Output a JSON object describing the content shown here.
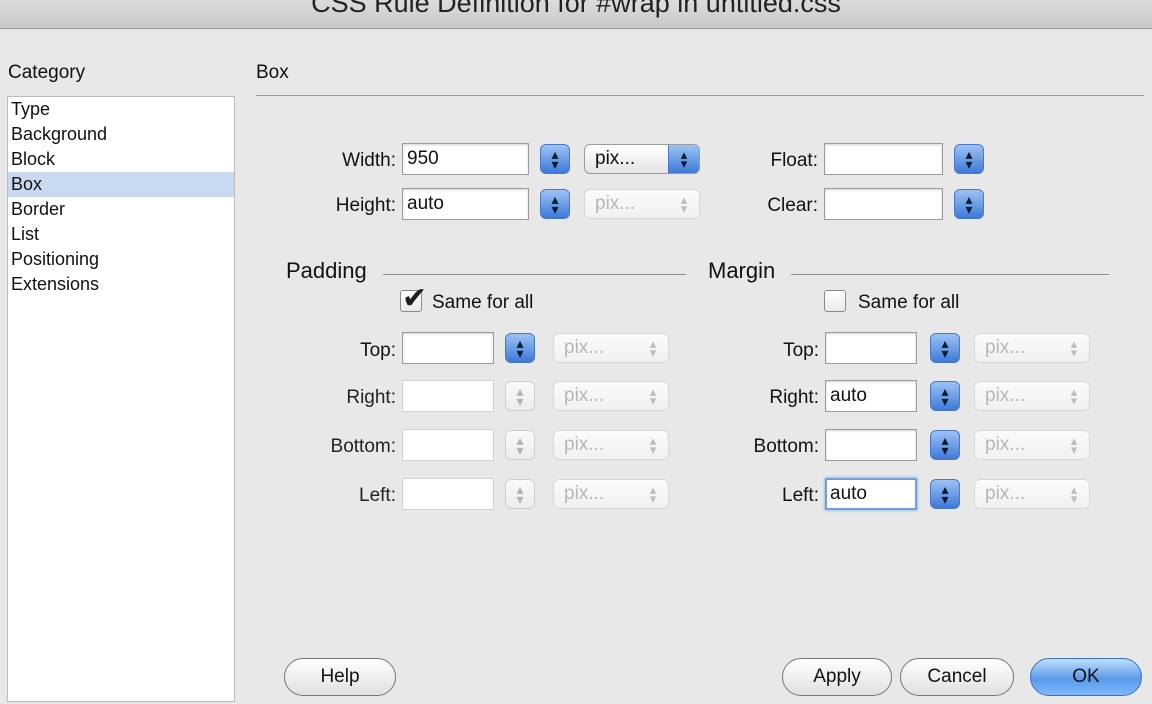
{
  "window": {
    "title": "CSS Rule Definition for #wrap in untitled.css"
  },
  "sidebar": {
    "label": "Category",
    "items": [
      "Type",
      "Background",
      "Block",
      "Box",
      "Border",
      "List",
      "Positioning",
      "Extensions"
    ],
    "selected": "Box"
  },
  "section": {
    "title": "Box"
  },
  "dimensions": {
    "width": {
      "label": "Width:",
      "value": "950",
      "unit": "pix..."
    },
    "height": {
      "label": "Height:",
      "value": "auto",
      "unit": "pix..."
    },
    "float": {
      "label": "Float:",
      "value": ""
    },
    "clear": {
      "label": "Clear:",
      "value": ""
    }
  },
  "padding": {
    "title": "Padding",
    "same_for_all": {
      "label": "Same for all",
      "checked": true
    },
    "top": {
      "label": "Top:",
      "value": "",
      "unit": "pix..."
    },
    "right": {
      "label": "Right:",
      "value": "",
      "unit": "pix..."
    },
    "bottom": {
      "label": "Bottom:",
      "value": "",
      "unit": "pix..."
    },
    "left": {
      "label": "Left:",
      "value": "",
      "unit": "pix..."
    }
  },
  "margin": {
    "title": "Margin",
    "same_for_all": {
      "label": "Same for all",
      "checked": false
    },
    "top": {
      "label": "Top:",
      "value": "",
      "unit": "pix..."
    },
    "right": {
      "label": "Right:",
      "value": "auto",
      "unit": "pix..."
    },
    "bottom": {
      "label": "Bottom:",
      "value": "",
      "unit": "pix..."
    },
    "left": {
      "label": "Left:",
      "value": "auto",
      "unit": "pix..."
    }
  },
  "buttons": {
    "help": "Help",
    "apply": "Apply",
    "cancel": "Cancel",
    "ok": "OK"
  },
  "colors": {
    "accent": "#5a9ae8",
    "selection": "#c9d9f0"
  }
}
